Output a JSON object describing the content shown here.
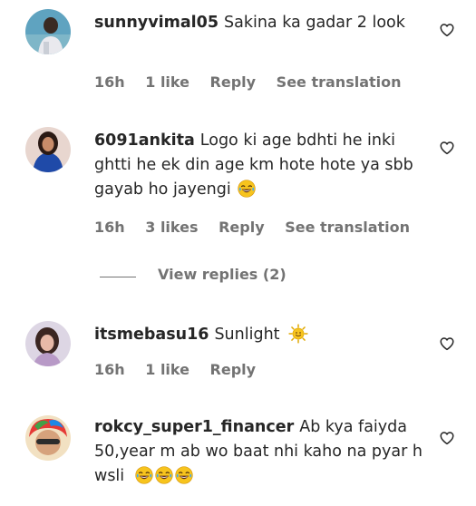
{
  "comments": [
    {
      "username": "sunnyvimal05",
      "text": "Sakina ka gadar 2 look",
      "time": "16h",
      "likes": "1 like",
      "reply": "Reply",
      "translate": "See translation"
    },
    {
      "username": "6091ankita",
      "text": "Logo ki age bdhti he inki ghtti he ek din age km hote hote ya sbb gayab ho jayengi",
      "time": "16h",
      "likes": "3 likes",
      "reply": "Reply",
      "translate": "See translation"
    },
    {
      "username": "itsmebasu16",
      "text": "Sunlight",
      "time": "16h",
      "likes": "1 like",
      "reply": "Reply"
    },
    {
      "username": "rokcy_super1_financer",
      "text": "Ab kya faiyda 50,year m ab wo baat nhi kaho na pyar h wsli"
    }
  ],
  "view_replies": "View replies (2)",
  "icons": {
    "like": "heart-outline-icon",
    "laugh": "tears-of-joy-emoji",
    "sun": "sun-emoji"
  },
  "colors": {
    "text": "#262626",
    "secondary": "#737373",
    "emoji": "#F7C41D"
  }
}
